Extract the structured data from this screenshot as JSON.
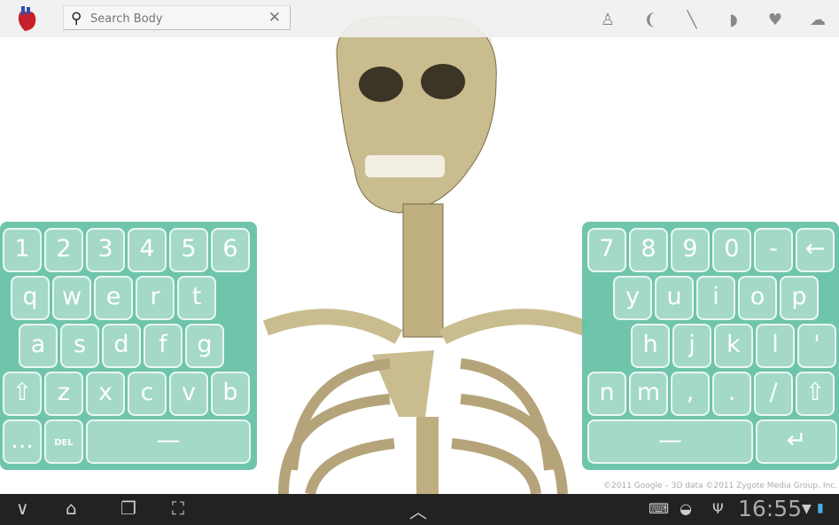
{
  "app": {
    "search_placeholder": "Search Body",
    "search_value": "",
    "layers": [
      {
        "icon": "skin-icon"
      },
      {
        "icon": "muscle-icon"
      },
      {
        "icon": "bone-icon"
      },
      {
        "icon": "organ-icon"
      },
      {
        "icon": "circulatory-icon"
      },
      {
        "icon": "nervous-icon"
      }
    ]
  },
  "keyboard_left": {
    "rows": [
      [
        "1",
        "2",
        "3",
        "4",
        "5",
        "6"
      ],
      [
        "q",
        "w",
        "e",
        "r",
        "t"
      ],
      [
        "a",
        "s",
        "d",
        "f",
        "g"
      ],
      [
        "⇧",
        "z",
        "x",
        "c",
        "v",
        "b"
      ],
      [
        "...",
        "DEL",
        "—"
      ]
    ]
  },
  "keyboard_right": {
    "rows": [
      [
        "7",
        "8",
        "9",
        "0",
        "-",
        "←"
      ],
      [
        "y",
        "u",
        "i",
        "o",
        "p"
      ],
      [
        "h",
        "j",
        "k",
        "l",
        "'"
      ],
      [
        "n",
        "m",
        ",",
        ".",
        "/",
        "⇧"
      ],
      [
        "—",
        "↵"
      ]
    ]
  },
  "credit": "©2011 Google – 3D data ©2011 Zygote Media Group, Inc.",
  "status": {
    "time": "16:55"
  },
  "colors": {
    "keyboard": "#64c1a5",
    "key": "#a3d9c6",
    "navbar": "#222222"
  }
}
